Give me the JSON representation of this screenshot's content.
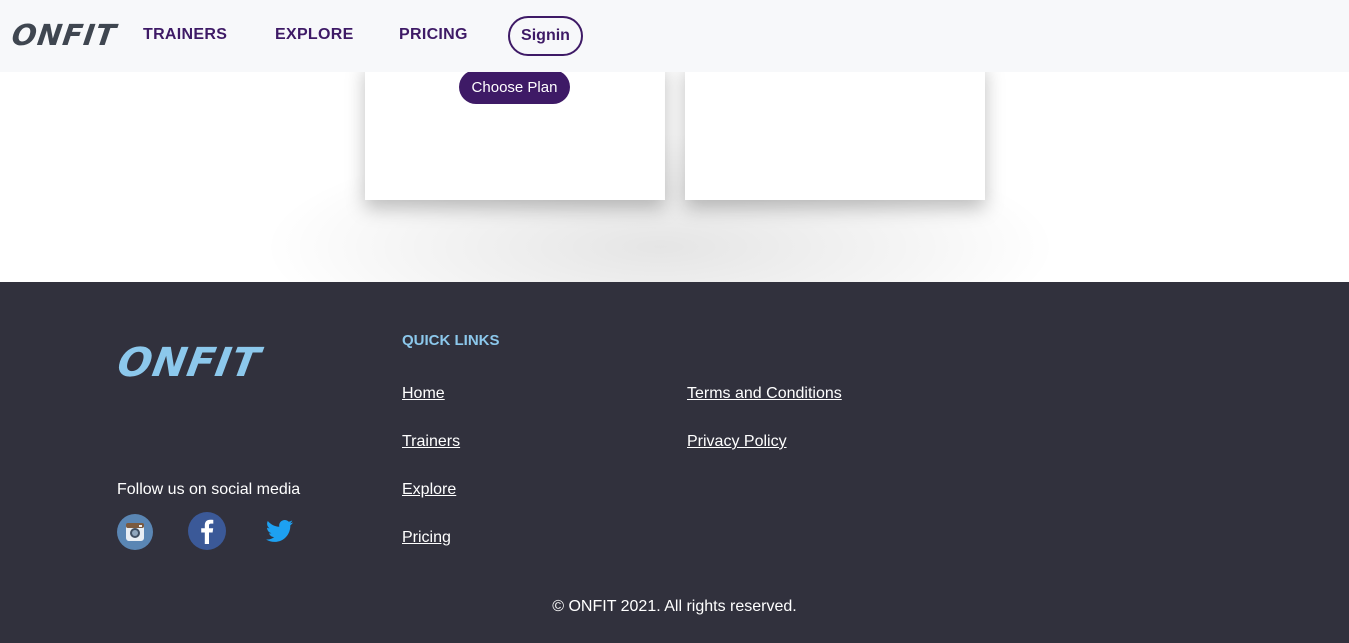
{
  "header": {
    "brand": "ONFIT",
    "nav": {
      "trainers": "TRAINERS",
      "explore": "EXPLORE",
      "pricing": "PRICING"
    },
    "signin_label": "Signin"
  },
  "pricing": {
    "choose_plan_label": "Choose Plan"
  },
  "footer": {
    "brand": "ONFIT",
    "quick_links_title": "QUICK LINKS",
    "links_col1": [
      "Home",
      "Trainers",
      "Explore",
      "Pricing"
    ],
    "links_col2": [
      "Terms and Conditions",
      "Privacy Policy"
    ],
    "follow_text": "Follow us on social media",
    "social_icons": [
      "instagram-icon",
      "facebook-icon",
      "twitter-icon"
    ],
    "copyright": "© ONFIT 2021. All rights reserved."
  },
  "colors": {
    "brand_purple": "#3e1a66",
    "footer_bg": "#31313d",
    "footer_accent": "#8cc8ec",
    "header_bg": "#f7f8fa"
  }
}
